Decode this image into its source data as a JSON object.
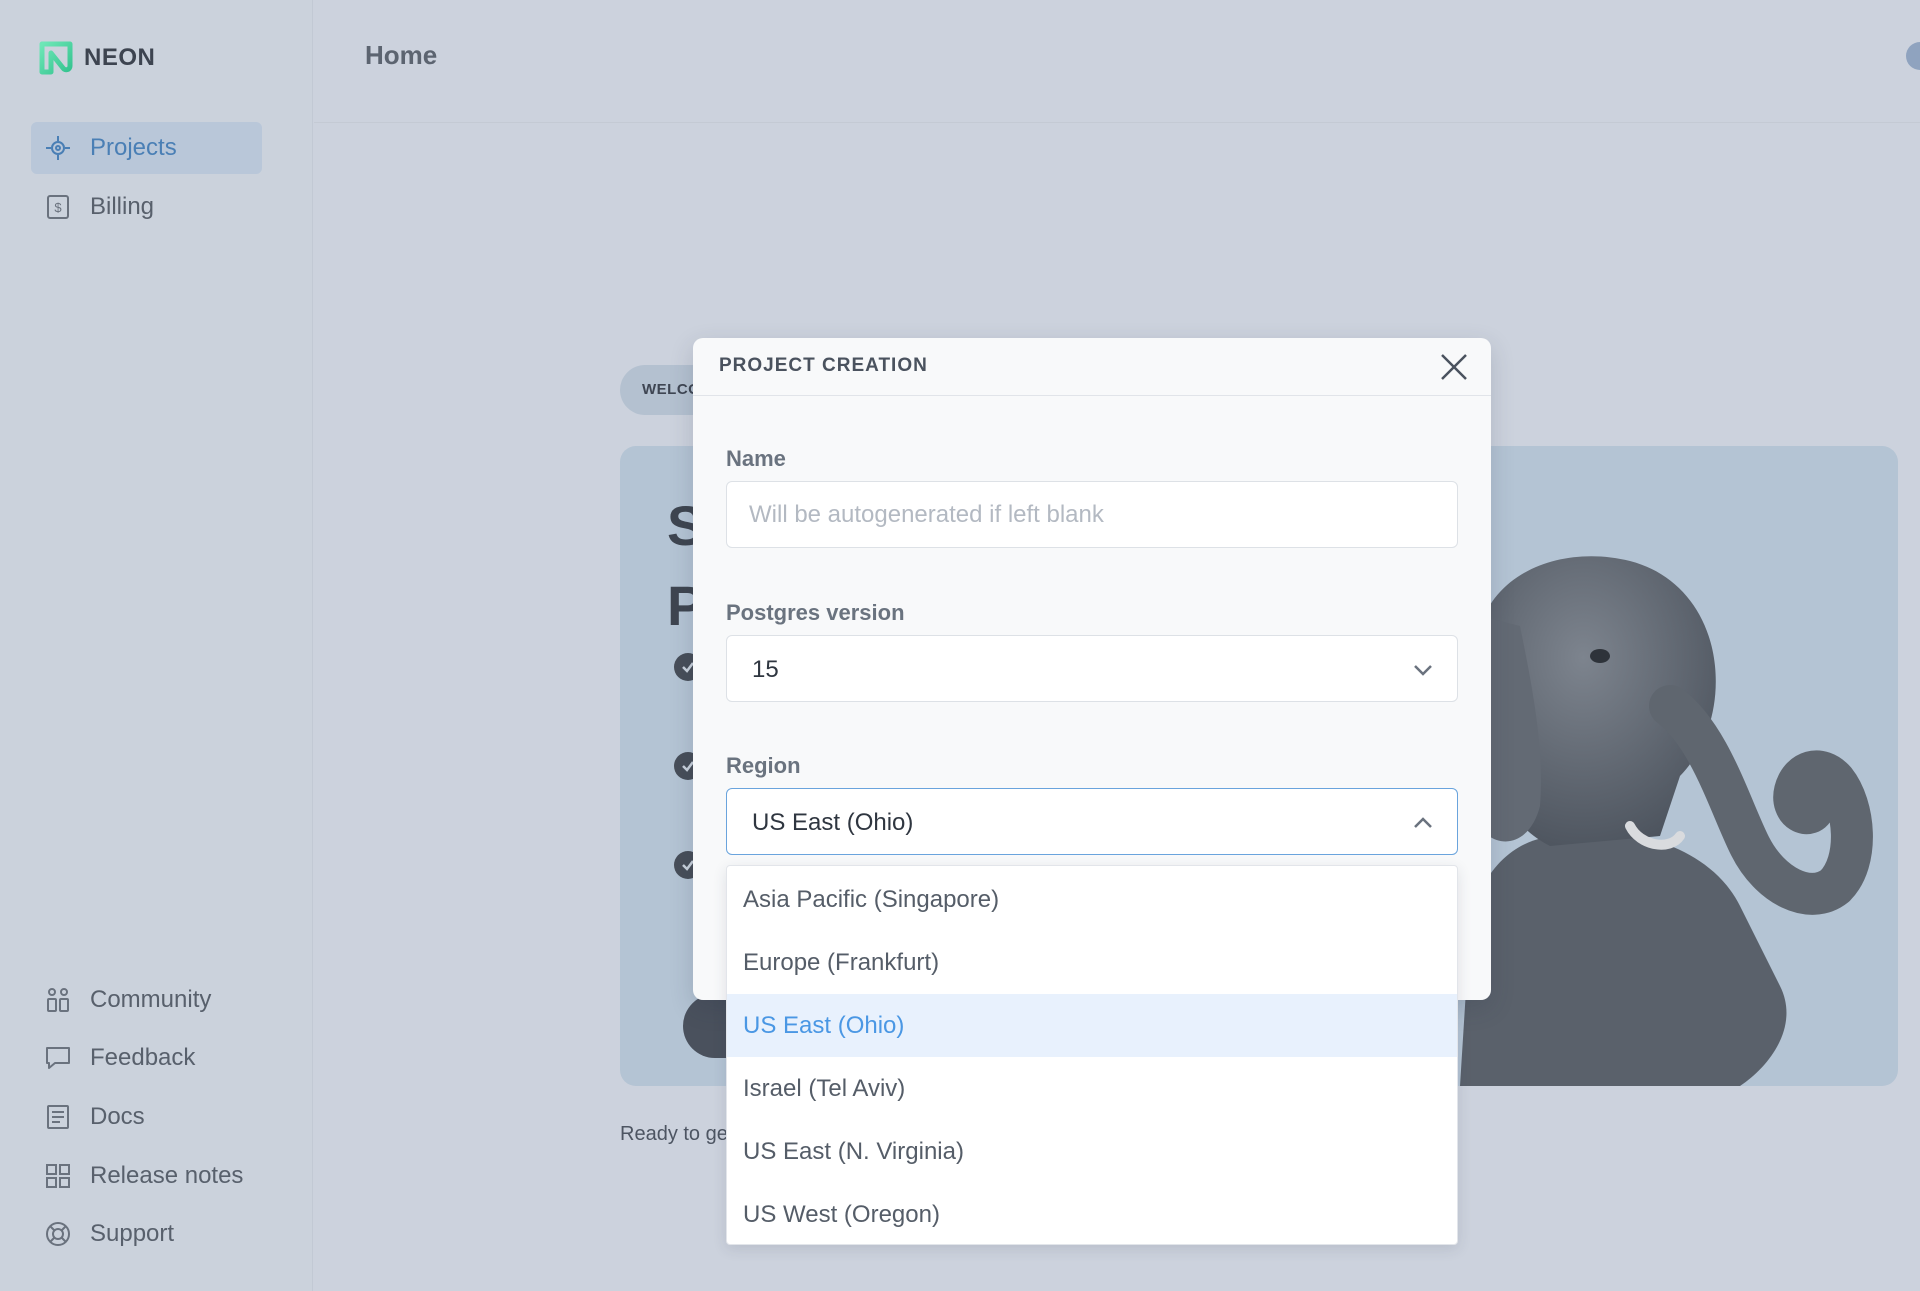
{
  "app": {
    "logo_text": "NEON"
  },
  "sidebar": {
    "top_items": [
      {
        "label": "Projects",
        "icon": "projects-icon",
        "active": true
      },
      {
        "label": "Billing",
        "icon": "billing-icon",
        "active": false
      }
    ],
    "bottom_items": [
      {
        "label": "Community",
        "icon": "community-icon"
      },
      {
        "label": "Feedback",
        "icon": "feedback-icon"
      },
      {
        "label": "Docs",
        "icon": "docs-icon"
      },
      {
        "label": "Release notes",
        "icon": "release-notes-icon"
      },
      {
        "label": "Support",
        "icon": "support-icon"
      }
    ]
  },
  "header": {
    "title": "Home"
  },
  "background": {
    "welcome_pill": "WELCO",
    "hero_heading_line1": "S",
    "hero_heading_line2": "P",
    "ready_text": "Ready to ge"
  },
  "modal": {
    "title": "PROJECT CREATION",
    "name_label": "Name",
    "name_value": "",
    "name_placeholder": "Will be autogenerated if left blank",
    "postgres_label": "Postgres version",
    "postgres_value": "15",
    "region_label": "Region",
    "region_value": "US East (Ohio)",
    "region_open": true
  },
  "region_options": [
    {
      "label": "Asia Pacific (Singapore)",
      "selected": false
    },
    {
      "label": "Europe (Frankfurt)",
      "selected": false
    },
    {
      "label": "US East (Ohio)",
      "selected": true
    },
    {
      "label": "Israel (Tel Aviv)",
      "selected": false
    },
    {
      "label": "US East (N. Virginia)",
      "selected": false
    },
    {
      "label": "US West (Oregon)",
      "selected": false
    }
  ],
  "colors": {
    "accent": "#4a97e4",
    "brand_green": "#3ddc97",
    "active_nav_text": "#4a7fb5",
    "overlay_bg": "#ccd2dd"
  }
}
